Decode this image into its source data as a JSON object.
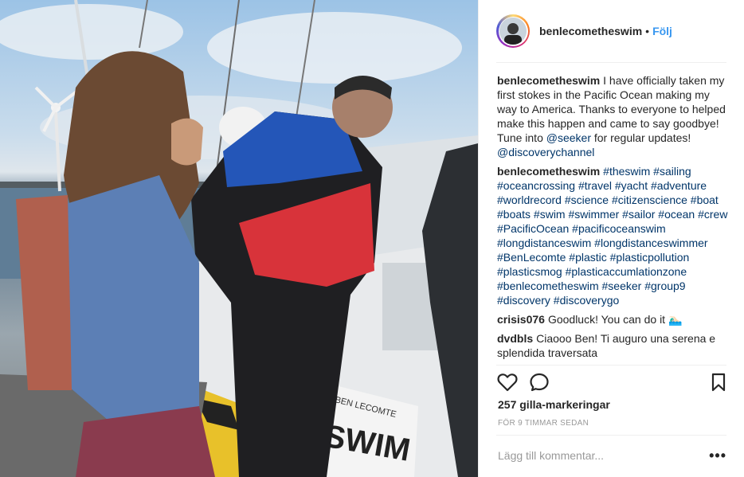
{
  "post": {
    "username": "benlecometheswim",
    "separator": "•",
    "follow_label": "Följ",
    "photo_sign_text": "BEN LECOMTE",
    "photo_banner_text": "SWIM"
  },
  "comments": [
    {
      "user": "benlecometheswim",
      "parts": [
        {
          "text": "I have officially taken my first stokes in the Pacific Ocean making my way to America. Thanks to everyone to helped make this happen and came to say goodbye! Tune into ",
          "link": false
        },
        {
          "text": "@seeker",
          "link": true
        },
        {
          "text": " for regular updates! ",
          "link": false
        },
        {
          "text": "@discoverychannel",
          "link": true
        }
      ]
    },
    {
      "user": "benlecometheswim",
      "parts": [
        {
          "text": "#theswim #sailing #oceancrossing #travel #yacht #adventure #worldrecord #science #citizenscience #boat #boats #swim #swimmer #sailor #ocean #crew #PacificOcean #pacificoceanswim #longdistanceswim #longdistanceswimmer #BenLecomte #plastic #plasticpollution #plasticsmog #plasticaccumlationzone #benlecometheswim #seeker #group9 #discovery #discoverygo",
          "link": true
        }
      ]
    },
    {
      "user": "crisis076",
      "parts": [
        {
          "text": "Goodluck! You can do it 🏊🏻‍♂️",
          "link": false
        }
      ]
    },
    {
      "user": "dvdbls",
      "parts": [
        {
          "text": "Ciaooo Ben! Ti auguro una serena e splendida traversata",
          "link": false
        }
      ]
    }
  ],
  "actions": {
    "like_icon": "heart-icon",
    "comment_icon": "speech-bubble-icon",
    "save_icon": "bookmark-icon"
  },
  "likes_text": "257 gilla-markeringar",
  "timestamp": "FÖR 9 TIMMAR SEDAN",
  "add_comment_placeholder": "Lägg till kommentar...",
  "more_label": "•••",
  "colors": {
    "link": "#003569",
    "follow": "#3897f0",
    "text": "#262626",
    "muted": "#999999"
  }
}
